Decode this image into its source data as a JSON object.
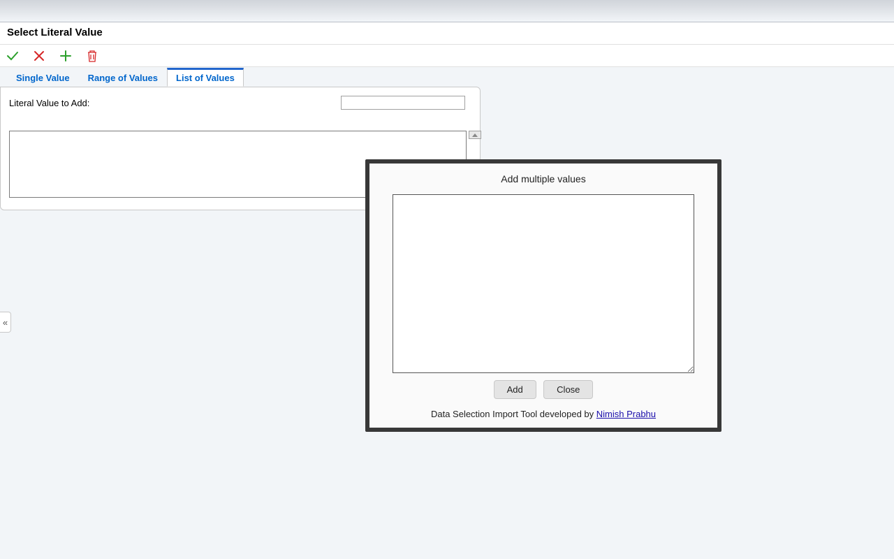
{
  "header": {
    "title": "Select Literal Value"
  },
  "toolbar": {
    "ok_label": "OK",
    "cancel_label": "Cancel",
    "add_label": "Add",
    "delete_label": "Delete"
  },
  "tabs": {
    "single_value": "Single Value",
    "range_of_values": "Range of Values",
    "list_of_values": "List of Values"
  },
  "form": {
    "literal_label": "Literal Value to Add:",
    "literal_value": "",
    "value_list": ""
  },
  "collapse": {
    "symbol": "«"
  },
  "modal": {
    "title": "Add multiple values",
    "textarea_value": "",
    "add_button": "Add",
    "close_button": "Close",
    "footer_text": "Data Selection Import Tool developed by ",
    "footer_link": "Nimish Prabhu"
  }
}
